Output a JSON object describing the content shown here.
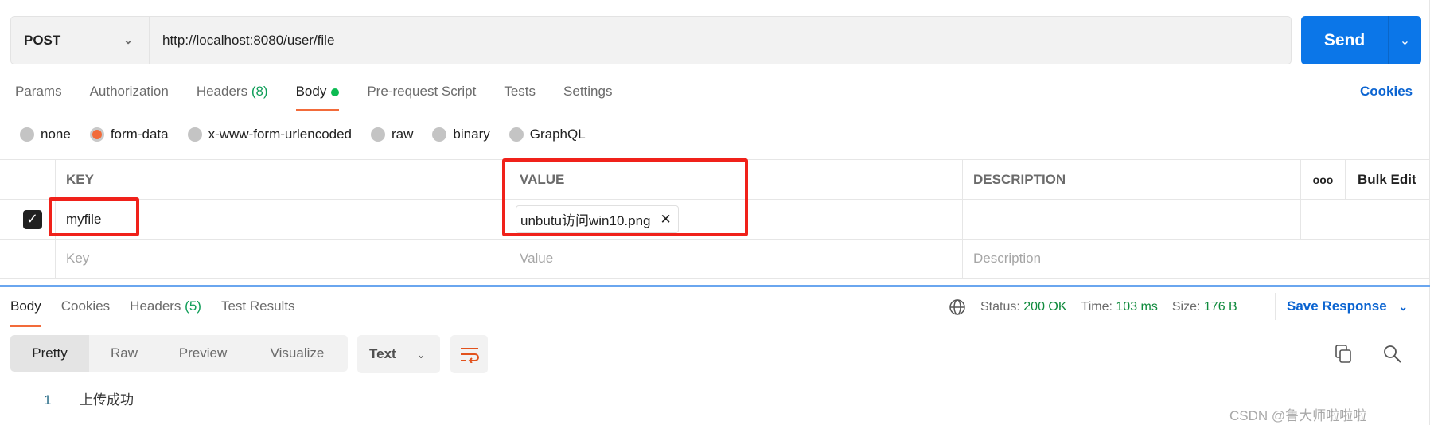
{
  "request": {
    "method": "POST",
    "url": "http://localhost:8080/user/file",
    "send_label": "Send"
  },
  "tabs": [
    {
      "label": "Params"
    },
    {
      "label": "Authorization"
    },
    {
      "label": "Headers",
      "count": "(8)"
    },
    {
      "label": "Body",
      "active": true
    },
    {
      "label": "Pre-request Script"
    },
    {
      "label": "Tests"
    },
    {
      "label": "Settings"
    }
  ],
  "cookies_label": "Cookies",
  "body_types": [
    "none",
    "form-data",
    "x-www-form-urlencoded",
    "raw",
    "binary",
    "GraphQL"
  ],
  "body_type_selected": "form-data",
  "table": {
    "headers": {
      "key": "KEY",
      "value": "VALUE",
      "description": "DESCRIPTION",
      "more": "ooo",
      "bulk_edit": "Bulk Edit"
    },
    "rows": [
      {
        "checked": true,
        "key": "myfile",
        "value": "unbutu访问win10.png",
        "description": ""
      }
    ],
    "placeholders": {
      "key": "Key",
      "value": "Value",
      "description": "Description"
    }
  },
  "response": {
    "tabs": [
      {
        "label": "Body",
        "active": true
      },
      {
        "label": "Cookies"
      },
      {
        "label": "Headers",
        "count": "(5)"
      },
      {
        "label": "Test Results"
      }
    ],
    "status_label": "Status:",
    "status": "200 OK",
    "time_label": "Time:",
    "time": "103 ms",
    "size_label": "Size:",
    "size": "176 B",
    "save_label": "Save Response",
    "views": [
      "Pretty",
      "Raw",
      "Preview",
      "Visualize"
    ],
    "format": "Text",
    "lines": [
      {
        "n": "1",
        "text": "上传成功"
      }
    ]
  },
  "watermark": "CSDN @鲁大师啦啦啦",
  "colors": {
    "accent": "#0b76e8",
    "tab_underline": "#f26b3a",
    "status_ok": "#0f8a3c",
    "highlight_box": "#f0211a"
  }
}
